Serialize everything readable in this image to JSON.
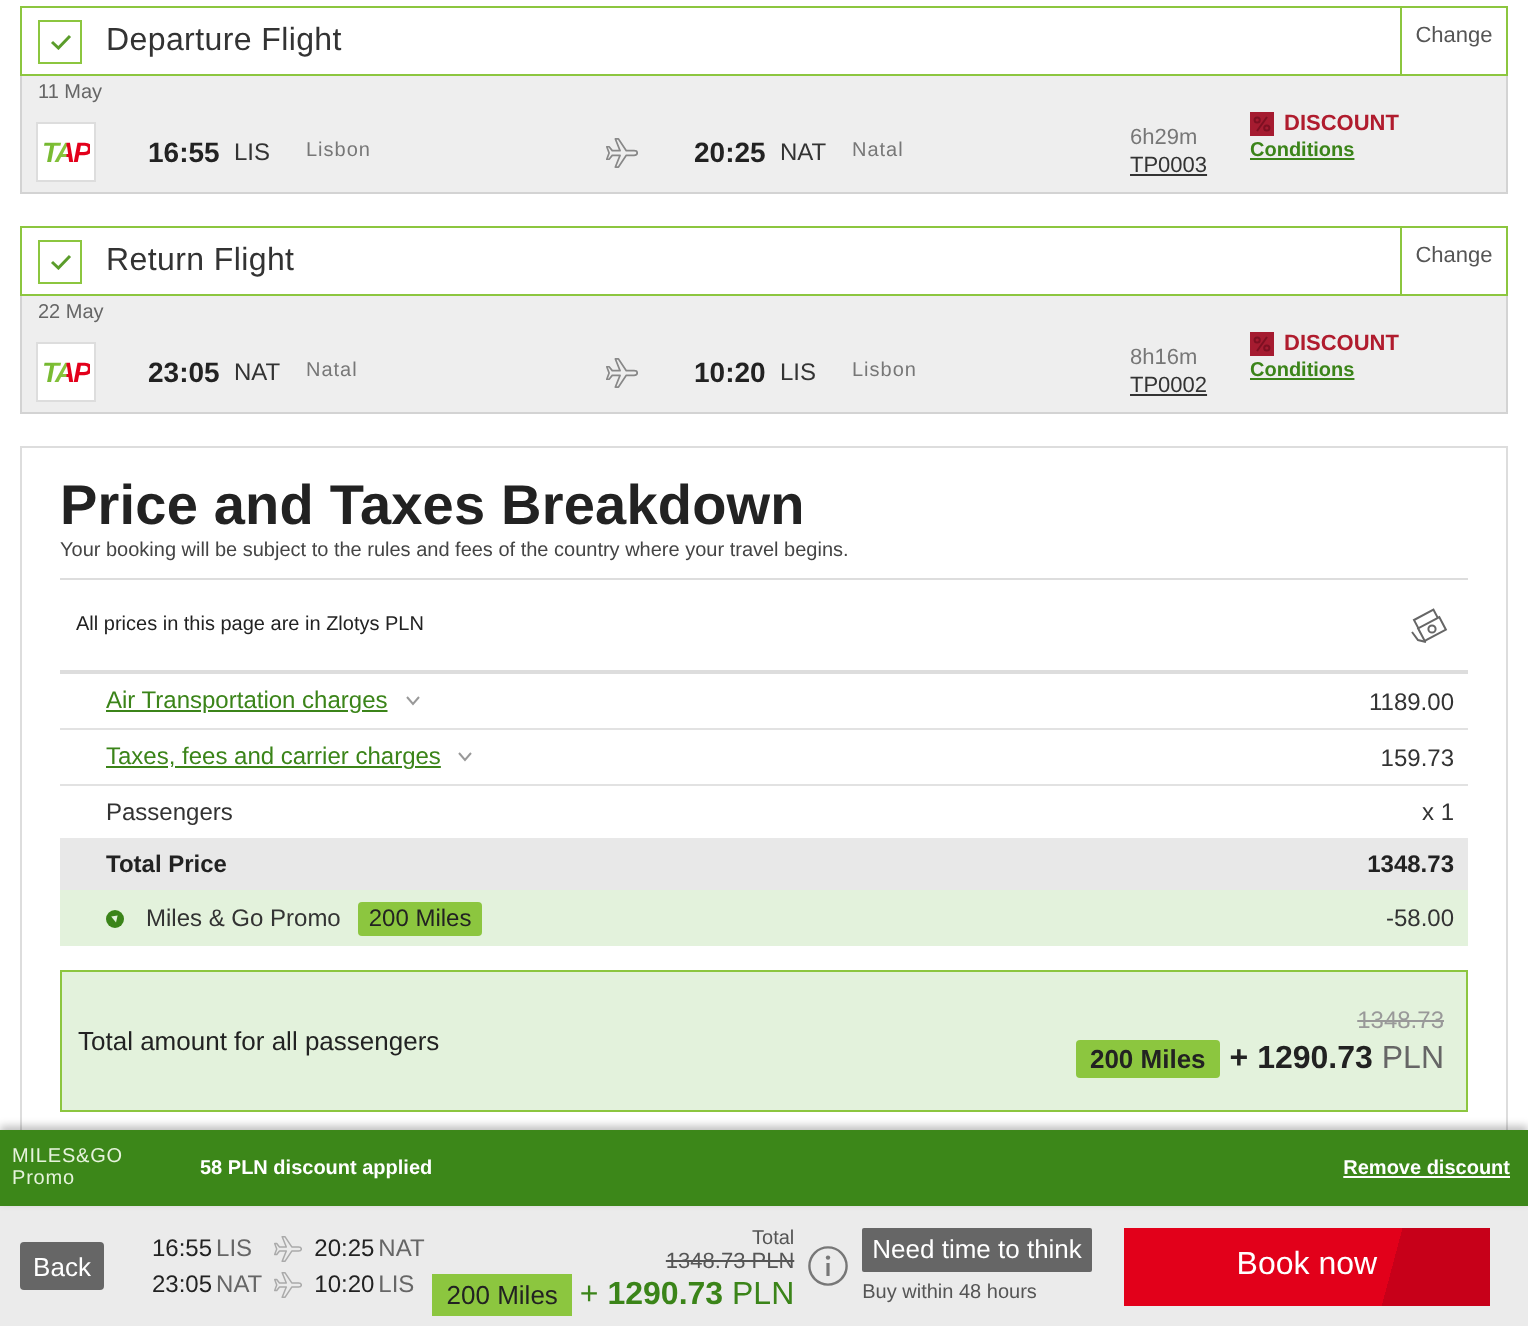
{
  "flights": [
    {
      "title": "Departure Flight",
      "checked": true,
      "change": "Change",
      "date": "11 May",
      "airline_logo": "TAP",
      "departure": {
        "time": "16:55",
        "code": "LIS",
        "city": "Lisbon"
      },
      "arrival": {
        "time": "20:25",
        "code": "NAT",
        "city": "Natal"
      },
      "duration": "6h29m",
      "flight_number": "TP0003",
      "fare": "DISCOUNT",
      "conditions": "Conditions"
    },
    {
      "title": "Return Flight",
      "checked": true,
      "change": "Change",
      "date": "22 May",
      "airline_logo": "TAP",
      "departure": {
        "time": "23:05",
        "code": "NAT",
        "city": "Natal"
      },
      "arrival": {
        "time": "10:20",
        "code": "LIS",
        "city": "Lisbon"
      },
      "duration": "8h16m",
      "flight_number": "TP0002",
      "fare": "DISCOUNT",
      "conditions": "Conditions"
    }
  ],
  "price_breakdown": {
    "title": "Price and Taxes Breakdown",
    "subtitle": "Your booking will be subject to the rules and fees of the country where your travel begins.",
    "currency_note": "All prices in this page are in Zlotys PLN",
    "rows": [
      {
        "kind": "expandable",
        "label": "Air Transportation charges",
        "expanded": false,
        "value": "1189.00"
      },
      {
        "kind": "expandable",
        "label": "Taxes, fees and carrier charges",
        "expanded": false,
        "value": "159.73"
      },
      {
        "kind": "plain",
        "label": "Passengers",
        "value": "x 1"
      },
      {
        "kind": "total",
        "label": "Total Price",
        "value": "1348.73"
      },
      {
        "kind": "promo",
        "label": "Miles & Go Promo",
        "badge": "200 Miles",
        "value": "-58.00"
      }
    ],
    "total_box": {
      "label": "Total amount for all passengers",
      "original_price": "1348.73",
      "miles": "200 Miles",
      "amount": "**+ 1290.73** PLN"
    }
  },
  "promo_bar": {
    "logo": [
      "MILES&GO",
      "Promo"
    ],
    "message": "58 PLN discount applied",
    "remove_link": "Remove discount"
  },
  "booking_bar": {
    "back": "Back",
    "legs": [
      {
        "departure_time": "16:55",
        "departure_code": "LIS",
        "arrival_time": "20:25",
        "arrival_code": "NAT"
      },
      {
        "departure_time": "23:05",
        "departure_code": "NAT",
        "arrival_time": "10:20",
        "arrival_code": "LIS"
      }
    ],
    "total_label": "Total",
    "original_price": "1348.73 PLN",
    "miles": "200 Miles",
    "amount": "+ **1290.73** PLN",
    "think_button": "Need time to think",
    "think_note": "Buy within 48 hours",
    "book_button": "Book now"
  }
}
